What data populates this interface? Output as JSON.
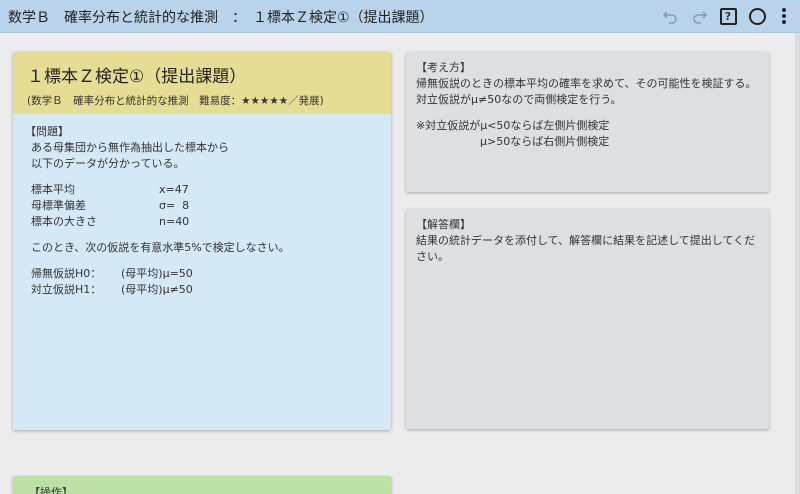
{
  "header": {
    "title": "数学Ｂ　確率分布と統計的な推測　：　１標本Ｚ検定①（提出課題）"
  },
  "toolbar": {
    "undo_glyph": "↶",
    "redo_glyph": "↷",
    "help_label": "?"
  },
  "colors": {
    "topbar": "#b9d3ea",
    "title_card": "#e6dd94",
    "problem_card": "#d4e8f6",
    "info_card": "#dedfe0",
    "ops_card": "#bde1a5"
  },
  "problem_card": {
    "title": "１標本Ｚ検定①（提出課題）",
    "subtitle": "(数学Ｂ　確率分布と統計的な推測　難易度：★★★★★／発展)",
    "section_label": "【問題】",
    "intro_line1": "ある母集団から無作為抽出した標本から",
    "intro_line2": "以下のデータが分かっている。",
    "stats": [
      {
        "label": "標本平均",
        "value": "x=47"
      },
      {
        "label": "母標準偏差",
        "value": "σ=  8"
      },
      {
        "label": "標本の大きさ",
        "value": "n=40"
      }
    ],
    "instruction": "このとき、次の仮説を有意水準5%で検定しなさい。",
    "hypotheses": [
      {
        "label": "帰無仮説H0：",
        "value": "(母平均)μ=50"
      },
      {
        "label": "対立仮説H1：",
        "value": "(母平均)μ≠50"
      }
    ]
  },
  "approach_card": {
    "section_label": "【考え方】",
    "line1": "帰無仮説のときの標本平均の確率を求めて、その可能性を検証する。",
    "line2": "対立仮説がμ≠50なので両側検定を行う。",
    "note1": "※対立仮説がμ<50ならば左側片側検定",
    "note2": "μ>50ならば右側片側検定"
  },
  "answer_card": {
    "section_label": "【解答欄】",
    "text": "結果の統計データを添付して、解答欄に結果を記述して提出してください。"
  },
  "operation_card": {
    "section_label": "【操作】"
  }
}
